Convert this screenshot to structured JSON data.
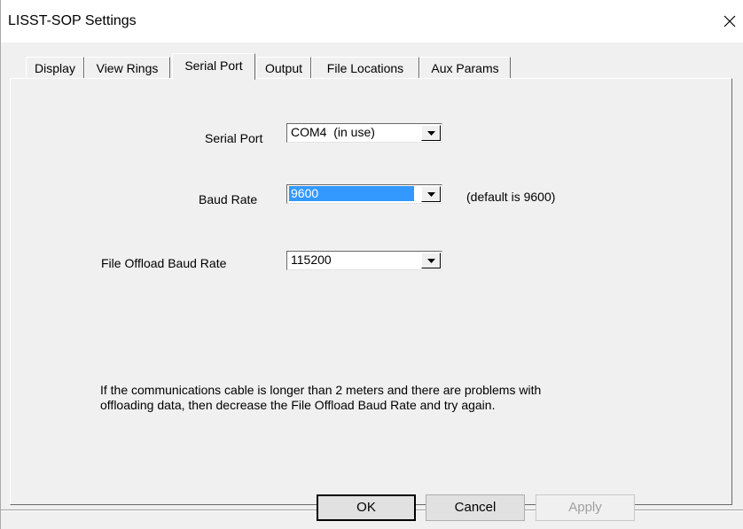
{
  "window": {
    "title": "LISST-SOP Settings"
  },
  "tabs": [
    {
      "label": "Display",
      "active": false
    },
    {
      "label": "View Rings",
      "active": false
    },
    {
      "label": "Serial Port",
      "active": true
    },
    {
      "label": "Output",
      "active": false
    },
    {
      "label": "File Locations",
      "active": false
    },
    {
      "label": "Aux Params",
      "active": false
    }
  ],
  "serial_port": {
    "label": "Serial Port",
    "value": "COM4  (in use)"
  },
  "baud_rate": {
    "label": "Baud Rate",
    "value": "9600",
    "hint": "(default is 9600)"
  },
  "file_offload_baud_rate": {
    "label": "File Offload Baud Rate",
    "value": "115200"
  },
  "note": {
    "line1": "If the communications cable is longer than 2 meters and there are problems with",
    "line2": "offloading data, then decrease the File Offload Baud Rate and try again."
  },
  "buttons": {
    "ok": "OK",
    "cancel": "Cancel",
    "apply": "Apply"
  },
  "colors": {
    "selection": "#3399ff",
    "disabled_text": "#a0a0a0"
  },
  "icons": {
    "close": "close-icon",
    "dropdown": "chevron-down-icon"
  }
}
